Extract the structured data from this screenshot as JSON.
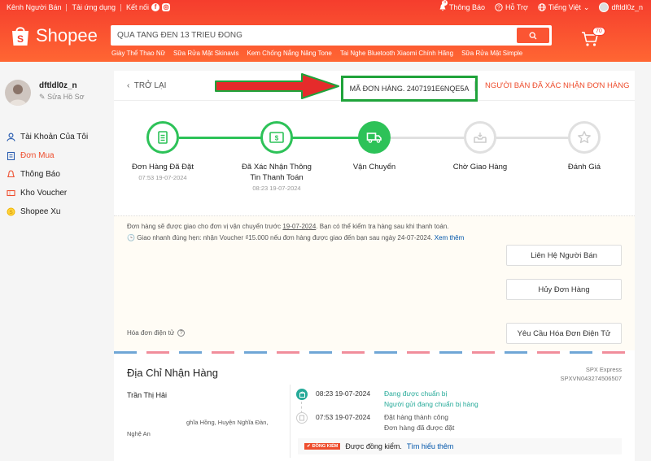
{
  "topbar": {
    "seller_channel": "Kênh Người Bán",
    "download_app": "Tải ứng dụng",
    "connect": "Kết nối",
    "notifications": "Thông Báo",
    "notifications_badge": "5",
    "help": "Hỗ Trợ",
    "language": "Tiếng Việt",
    "username": "dftldl0z_n"
  },
  "header": {
    "logo_text": "Shopee",
    "search_value": "QUA TANG ĐEN 13 TRIEU ĐONG",
    "cart_count": "70",
    "hot_keywords": [
      "Giày Thể Thao Nữ",
      "Sữa Rửa Mặt Skinavis",
      "Kem Chống Nắng Nâng Tone",
      "Tai Nghe Bluetooth Xiaomi Chính Hãng",
      "Sữa Rửa Mặt Simple"
    ]
  },
  "sidebar": {
    "username": "dftldl0z_n",
    "edit_profile": "Sửa Hồ Sơ",
    "items": [
      {
        "label": "Tài Khoản Của Tôi",
        "icon": "user-icon",
        "color": "#2a5db0"
      },
      {
        "label": "Đơn Mua",
        "icon": "clipboard-icon",
        "color": "#2a5db0"
      },
      {
        "label": "Thông Báo",
        "icon": "bell-icon",
        "color": "#ee4d2d"
      },
      {
        "label": "Kho Voucher",
        "icon": "voucher-icon",
        "color": "#ee4d2d"
      },
      {
        "label": "Shopee Xu",
        "icon": "coin-icon",
        "color": "#f0b400"
      }
    ]
  },
  "order": {
    "back_label": "TRỞ LẠI",
    "order_id": "MÃ ĐƠN HÀNG. 2407191E6NQE5A",
    "status": "NGƯỜI BÁN ĐÃ XÁC NHẬN ĐƠN HÀNG",
    "steps": [
      {
        "label": "Đơn Hàng Đã Đặt",
        "time": "07:53 19-07-2024",
        "icon": "receipt-icon"
      },
      {
        "label": "Đã Xác Nhận Thông Tin Thanh Toán",
        "time": "08:23 19-07-2024",
        "icon": "payment-icon"
      },
      {
        "label": "Vận Chuyển",
        "time": "",
        "icon": "truck-icon"
      },
      {
        "label": "Chờ Giao Hàng",
        "time": "",
        "icon": "inbox-icon"
      },
      {
        "label": "Đánh Giá",
        "time": "",
        "icon": "star-icon"
      }
    ],
    "notice_prefix": "Đơn hàng sẽ được giao cho đơn vị vận chuyển trước",
    "notice_date": "19-07-2024",
    "notice_suffix": ". Bạn có thể kiểm tra hàng sau khi thanh toán.",
    "fast_notice": "Giao nhanh đúng hẹn: nhận Voucher ₫15.000 nếu đơn hàng được giao đến bạn sau ngày 24-07-2024.",
    "see_more": "Xem thêm",
    "buttons": {
      "contact_seller": "Liên Hệ Người Bán",
      "cancel_order": "Hủy Đơn Hàng",
      "request_invoice": "Yêu Cầu Hóa Đơn Điện Tử"
    },
    "e_invoice_label": "Hóa đơn điện tử"
  },
  "address": {
    "title": "Địa Chỉ Nhận Hàng",
    "carrier": "SPX Express",
    "tracking": "SPXVN043274506507",
    "recipient": "Trần Thị Hải",
    "line": "ghĩa Hồng, Huyện Nghĩa Đàn,",
    "province": "Nghệ An",
    "timeline": [
      {
        "time": "08:23 19-07-2024",
        "status": "Đang được chuẩn bị",
        "desc": "Người gửi đang chuẩn bị hàng"
      },
      {
        "time": "07:53 19-07-2024",
        "status": "Đặt hàng thành công",
        "desc": "Đơn hàng đã được đặt"
      }
    ],
    "inspect_badge": "ĐỒNG KIỂM",
    "inspect_text": "Được đồng kiểm.",
    "inspect_link": "Tìm hiểu thêm"
  }
}
